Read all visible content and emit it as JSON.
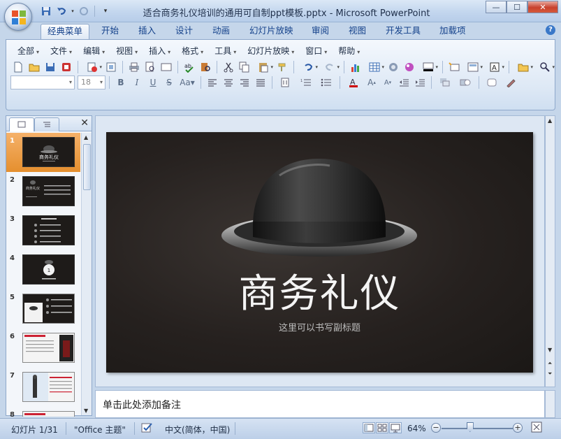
{
  "window": {
    "title": "适合商务礼仪培训的通用可自制ppt模板.pptx - Microsoft PowerPoint",
    "minimize": "—",
    "maximize": "☐",
    "close": "✕"
  },
  "ribbon_tabs": [
    {
      "label": "经典菜单",
      "active": true
    },
    {
      "label": "开始"
    },
    {
      "label": "插入"
    },
    {
      "label": "设计"
    },
    {
      "label": "动画"
    },
    {
      "label": "幻灯片放映"
    },
    {
      "label": "审阅"
    },
    {
      "label": "视图"
    },
    {
      "label": "开发工具"
    },
    {
      "label": "加载项"
    }
  ],
  "menubar": [
    "全部",
    "文件",
    "编辑",
    "视图",
    "插入",
    "格式",
    "工具",
    "幻灯片放映",
    "窗口",
    "帮助"
  ],
  "format": {
    "font_size": "18"
  },
  "panel": {
    "close": "✕",
    "slides": [
      "1",
      "2",
      "3",
      "4",
      "5",
      "6",
      "7",
      "8"
    ],
    "selected": 1
  },
  "slide": {
    "title": "商务礼仪",
    "subtitle": "这里可以书写副标题"
  },
  "notes": {
    "placeholder": "单击此处添加备注"
  },
  "status": {
    "slide_info": "幻灯片 1/31",
    "theme": "\"Office 主题\"",
    "language": "中文(简体，中国)",
    "zoom": "64%",
    "zoom_fraction": 0.4
  },
  "colors": {
    "ribbon_accent": "#15428b",
    "selected_thumb": "#e58f2e",
    "slide_bg": "#26211f",
    "close_button": "#c8412d"
  }
}
